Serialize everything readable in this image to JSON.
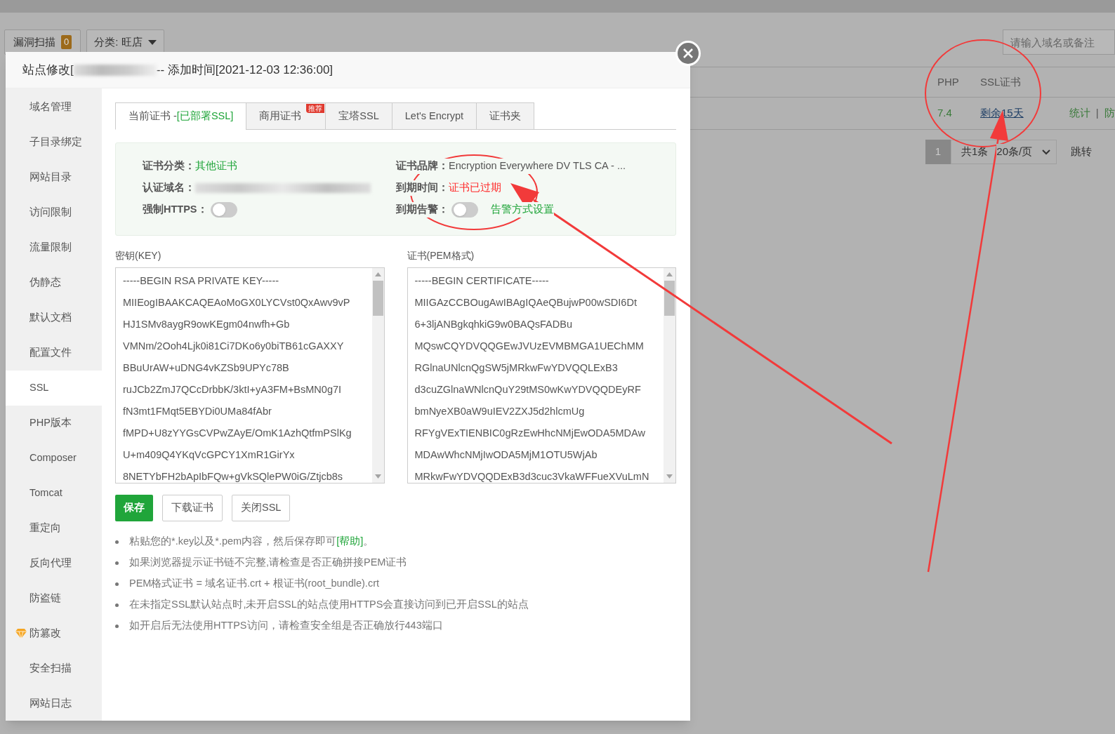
{
  "background": {
    "toolbar": {
      "scan_button": {
        "label": "漏洞扫描",
        "count": "0"
      },
      "category": {
        "label": "分类: 旺店"
      },
      "search": {
        "placeholder": "请输入域名或备注"
      }
    },
    "table": {
      "columns": [
        "PHP",
        "SSL证书"
      ],
      "row": {
        "php": "7.4",
        "ssl": "剩余15天",
        "actions": [
          "统计",
          "防"
        ],
        "separator": "|"
      }
    },
    "pagination": {
      "page": "1",
      "total": "共1条",
      "per_page": "20条/页",
      "jump": "跳转"
    }
  },
  "modal": {
    "title_prefix": "站点修改[",
    "title_suffix": "-- 添加时间[2021-12-03 12:36:00]",
    "sidebar": [
      {
        "label": "域名管理",
        "selected": false
      },
      {
        "label": "子目录绑定",
        "selected": false
      },
      {
        "label": "网站目录",
        "selected": false
      },
      {
        "label": "访问限制",
        "selected": false
      },
      {
        "label": "流量限制",
        "selected": false
      },
      {
        "label": "伪静态",
        "selected": false
      },
      {
        "label": "默认文档",
        "selected": false
      },
      {
        "label": "配置文件",
        "selected": false
      },
      {
        "label": "SSL",
        "selected": true
      },
      {
        "label": "PHP版本",
        "selected": false
      },
      {
        "label": "Composer",
        "selected": false
      },
      {
        "label": "Tomcat",
        "selected": false
      },
      {
        "label": "重定向",
        "selected": false
      },
      {
        "label": "反向代理",
        "selected": false
      },
      {
        "label": "防盗链",
        "selected": false
      },
      {
        "label": "防篡改",
        "selected": false,
        "premium": true
      },
      {
        "label": "安全扫描",
        "selected": false
      },
      {
        "label": "网站日志",
        "selected": false
      }
    ],
    "tabs": [
      {
        "label": "当前证书 - ",
        "status": "[已部署SSL]",
        "selected": true
      },
      {
        "label": "商用证书",
        "ribbon": "推荐",
        "selected": false
      },
      {
        "label": "宝塔SSL",
        "selected": false
      },
      {
        "label": "Let's Encrypt",
        "selected": false
      },
      {
        "label": "证书夹",
        "selected": false
      }
    ],
    "info": {
      "category_label": "证书分类：",
      "category_value": "其他证书",
      "domain_label": "认证域名：",
      "https_label": "强制HTTPS：",
      "https_on": false,
      "brand_label": "证书品牌：",
      "brand_value": "Encryption Everywhere DV TLS CA - ...",
      "expiry_label": "到期时间：",
      "expiry_value": "证书已过期",
      "alert_label": "到期告警：",
      "alert_on": false,
      "alert_link": "告警方式设置"
    },
    "key": {
      "label": "密钥(KEY)",
      "lines": [
        "-----BEGIN RSA PRIVATE KEY-----",
        "MIIEogIBAAKCAQEAoMoGX0LYCVst0QxAwv9vP",
        "HJ1SMv8aygR9owKEgm04nwfh+Gb",
        "VMNm/2Ooh4Ljk0i81Ci7DKo6y0biTB61cGAXXY",
        "BBuUrAW+uDNG4vKZSb9UPYc78B",
        "ruJCb2ZmJ7QCcDrbbK/3ktI+yA3FM+BsMN0g7I",
        "fN3mt1FMqt5EBYDi0UMa84fAbr",
        "fMPD+U8zYYGsCVPwZAyE/OmK1AzhQtfmPSlKg",
        "U+m409Q4YKqVcGPCY1XmR1GirYx",
        "8NETYbFH2bApIbFQw+gVkSQlePW0iG/Ztjcb8s"
      ]
    },
    "cert": {
      "label": "证书(PEM格式)",
      "lines": [
        "-----BEGIN CERTIFICATE-----",
        "MIIGAzCCBOugAwIBAgIQAeQBujwP00wSDI6Dt",
        "6+3ljANBgkqhkiG9w0BAQsFADBu",
        "MQswCQYDVQQGEwJVUzEVMBMGA1UEChMM",
        "RGlnaUNlcnQgSW5jMRkwFwYDVQQLExB3",
        "d3cuZGlnaWNlcnQuY29tMS0wKwYDVQQDEyRF",
        "bmNyeXB0aW9uIEV2ZXJ5d2hlcmUg",
        "RFYgVExTIENBIC0gRzEwHhcNMjEwODA5MDAw",
        "MDAwWhcNMjIwODA5MjM1OTU5WjAb",
        "MRkwFwYDVQQDExB3d3cuc3VkaWFFueXVuLmN"
      ]
    },
    "buttons": [
      {
        "label": "保存",
        "kind": "primary"
      },
      {
        "label": "下载证书",
        "kind": "default"
      },
      {
        "label": "关闭SSL",
        "kind": "default"
      }
    ],
    "notes": [
      "粘贴您的*.key以及*.pem内容，然后保存即可**[帮助]**。",
      "如果浏览器提示证书链不完整,请检查是否正确拼接PEM证书",
      "PEM格式证书 = 域名证书.crt + 根证书(root_bundle).crt",
      "在未指定SSL默认站点时,未开启SSL的站点使用HTTPS会直接访问到已开启SSL的站点",
      "如开启后无法使用HTTPS访问，请检查安全组是否正确放行443端口"
    ]
  }
}
